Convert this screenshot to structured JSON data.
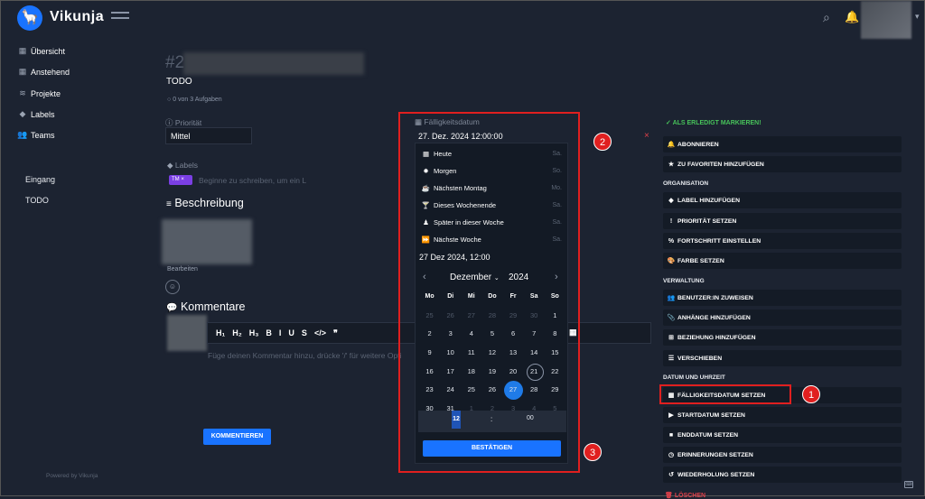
{
  "app": {
    "name": "Vikunja"
  },
  "sidebar": {
    "items": [
      {
        "label": "Übersicht",
        "icon": "calendar-icon"
      },
      {
        "label": "Anstehend",
        "icon": "calendar-icon"
      },
      {
        "label": "Projekte",
        "icon": "layers-icon"
      },
      {
        "label": "Labels",
        "icon": "tags-icon"
      },
      {
        "label": "Teams",
        "icon": "users-icon"
      }
    ],
    "projects": [
      "Eingang",
      "TODO"
    ],
    "powered": "Powered by Vikunja"
  },
  "task": {
    "number": "#2",
    "project": "TODO",
    "progress": "0 von 3 Aufgaben",
    "priority_label": "Priorität",
    "priority_value": "Mittel",
    "labels_label": "Labels",
    "label_chip": "TM",
    "label_placeholder": "Beginne zu schreiben, um ein L",
    "description_heading": "Beschreibung",
    "edit_link": "Bearbeiten",
    "comments_heading": "Kommentare",
    "editor_toolbar": [
      "H₁",
      "H₂",
      "H₃",
      "B",
      "I",
      "U",
      "S",
      "</>",
      "❞",
      "☰",
      "☷",
      "▦"
    ],
    "comment_placeholder": "Füge deinen Kommentar hinzu, drücke '/' für weitere Opti",
    "comment_button": "KOMMENTIEREN"
  },
  "datepicker": {
    "label": "Fälligkeitsdatum",
    "value": "27. Dez. 2024 12:00:00",
    "shortcuts": [
      {
        "label": "Heute",
        "day": "Sa.",
        "icon": "calendar-icon"
      },
      {
        "label": "Morgen",
        "day": "So.",
        "icon": "sun-icon"
      },
      {
        "label": "Nächsten Montag",
        "day": "Mo.",
        "icon": "coffee-icon"
      },
      {
        "label": "Dieses Wochenende",
        "day": "Sa.",
        "icon": "cocktail-icon"
      },
      {
        "label": "Später in dieser Woche",
        "day": "Sa.",
        "icon": "chess-icon"
      },
      {
        "label": "Nächste Woche",
        "day": "Sa.",
        "icon": "forward-icon"
      }
    ],
    "date_text": "27 Dez 2024, 12:00",
    "month": "Dezember",
    "year": "2024",
    "weekdays": [
      "Mo",
      "Di",
      "Mi",
      "Do",
      "Fr",
      "Sa",
      "So"
    ],
    "weeks": [
      [
        "25",
        "26",
        "27",
        "28",
        "29",
        "30",
        "1"
      ],
      [
        "2",
        "3",
        "4",
        "5",
        "6",
        "7",
        "8"
      ],
      [
        "9",
        "10",
        "11",
        "12",
        "13",
        "14",
        "15"
      ],
      [
        "16",
        "17",
        "18",
        "19",
        "20",
        "21",
        "22"
      ],
      [
        "23",
        "24",
        "25",
        "26",
        "27",
        "28",
        "29"
      ],
      [
        "30",
        "31",
        "1",
        "2",
        "3",
        "4",
        "5"
      ]
    ],
    "hour": "12",
    "separator": ":",
    "minute": "00",
    "confirm": "BESTÄTIGEN"
  },
  "actions": {
    "done": "ALS ERLEDIGT MARKIEREN!",
    "top": [
      {
        "label": "ABONNIEREN",
        "icon": "bell-icon"
      },
      {
        "label": "ZU FAVORITEN HINZUFÜGEN",
        "icon": "star-icon"
      }
    ],
    "org_heading": "ORGANISATION",
    "org": [
      {
        "label": "LABEL HINZUFÜGEN",
        "icon": "tags-icon"
      },
      {
        "label": "PRIORITÄT SETZEN",
        "icon": "exclamation-icon"
      },
      {
        "label": "FORTSCHRITT EINSTELLEN",
        "icon": "percent-icon"
      },
      {
        "label": "FARBE SETZEN",
        "icon": "palette-icon"
      }
    ],
    "admin_heading": "VERWALTUNG",
    "admin": [
      {
        "label": "BENUTZER:IN ZUWEISEN",
        "icon": "users-icon"
      },
      {
        "label": "ANHÄNGE HINZUFÜGEN",
        "icon": "paperclip-icon"
      },
      {
        "label": "BEZIEHUNG HINZUFÜGEN",
        "icon": "sitemap-icon"
      },
      {
        "label": "VERSCHIEBEN",
        "icon": "list-icon"
      }
    ],
    "date_heading": "DATUM UND UHRZEIT",
    "date": [
      {
        "label": "FÄLLIGKEITSDATUM SETZEN",
        "icon": "calendar-icon"
      },
      {
        "label": "STARTDATUM SETZEN",
        "icon": "play-icon"
      },
      {
        "label": "ENDDATUM SETZEN",
        "icon": "stop-icon"
      },
      {
        "label": "ERINNERUNGEN SETZEN",
        "icon": "clock-icon"
      },
      {
        "label": "WIEDERHOLUNG SETZEN",
        "icon": "history-icon"
      }
    ],
    "delete": "LÖSCHEN"
  },
  "annotations": [
    "1",
    "2",
    "3"
  ]
}
